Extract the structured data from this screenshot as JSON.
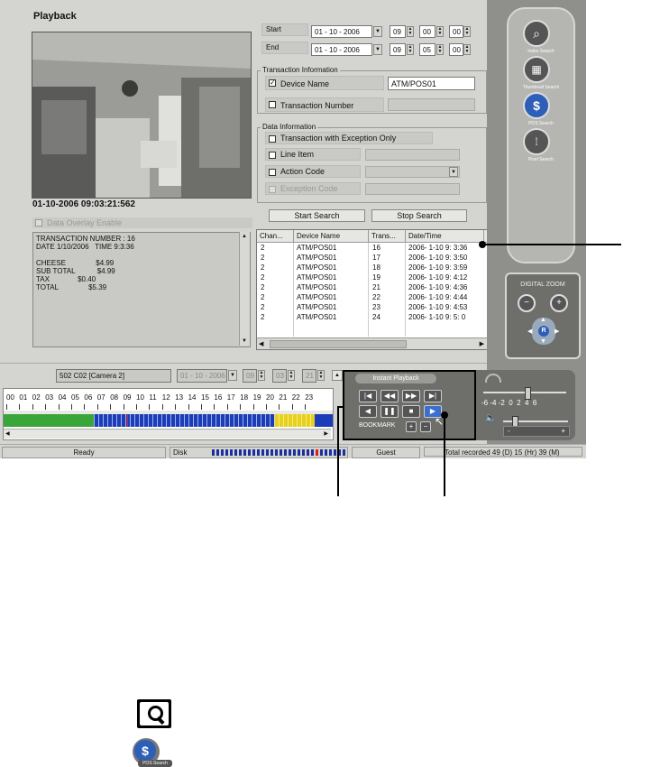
{
  "title": "Playback",
  "timestamp": "01-10-2006 09:03:21:562",
  "overlay_label": "Data Overlay Enable",
  "overlay_text": "TRANSACTION NUMBER : 16\nDATE 1/10/2006   TIME 9:3:36\n\nCHEESE               $4.99\nSUB TOTAL           $4.99\nTAX              $0.40\nTOTAL               $5.39",
  "time_range": {
    "start_label": "Start",
    "end_label": "End",
    "start_date": "01 - 10 - 2006",
    "start_h": "09",
    "start_m": "00",
    "start_s": "00",
    "end_date": "01 - 10 - 2006",
    "end_h": "09",
    "end_m": "05",
    "end_s": "00"
  },
  "transaction_info": {
    "title": "Transaction Information",
    "device_name_label": "Device Name",
    "device_name_value": "ATM/POS01",
    "transaction_number_label": "Transaction Number"
  },
  "data_info": {
    "title": "Data Information",
    "exception_only_label": "Transaction with Exception Only",
    "line_item_label": "Line Item",
    "action_code_label": "Action Code",
    "exception_code_label": "Exception Code"
  },
  "buttons": {
    "start_search": "Start Search",
    "stop_search": "Stop Search"
  },
  "results": {
    "columns": [
      "Chan...",
      "Device Name",
      "Trans...",
      "Date/Time"
    ],
    "rows": [
      [
        "2",
        "ATM/POS01",
        "16",
        "2006- 1-10  9: 3:36"
      ],
      [
        "2",
        "ATM/POS01",
        "17",
        "2006- 1-10  9: 3:50"
      ],
      [
        "2",
        "ATM/POS01",
        "18",
        "2006- 1-10  9: 3:59"
      ],
      [
        "2",
        "ATM/POS01",
        "19",
        "2006- 1-10  9: 4:12"
      ],
      [
        "2",
        "ATM/POS01",
        "21",
        "2006- 1-10  9: 4:36"
      ],
      [
        "2",
        "ATM/POS01",
        "22",
        "2006- 1-10  9: 4:44"
      ],
      [
        "2",
        "ATM/POS01",
        "23",
        "2006- 1-10  9: 4:53"
      ],
      [
        "2",
        "ATM/POS01",
        "24",
        "2006- 1-10  9: 5: 0"
      ]
    ]
  },
  "side_panel": {
    "index_search": "Index Search",
    "thumbnail_search": "Thumbnail Search",
    "pos_search": "POS Search",
    "pixel_search": "Pixel Search",
    "digital_zoom": "DIGITAL ZOOM",
    "zoom_center": "R"
  },
  "timeline": {
    "camera": "502 C02 [Camera 2]",
    "date": "01 - 10 - 2006",
    "h": "09",
    "m": "03",
    "s": "21",
    "hours": [
      "00",
      "01",
      "02",
      "03",
      "04",
      "05",
      "06",
      "07",
      "08",
      "09",
      "10",
      "11",
      "12",
      "13",
      "14",
      "15",
      "16",
      "17",
      "18",
      "19",
      "20",
      "21",
      "22",
      "23"
    ]
  },
  "instant_playback": {
    "title": "Instant Playback",
    "bookmark": "BOOKMARK",
    "speed_scale": "-6 -4 -2  0  2  4  6",
    "vol_minus": "-",
    "vol_plus": "+"
  },
  "status": {
    "ready": "Ready",
    "disk": "Disk",
    "user": "Guest",
    "total": "Total recorded 49 (D) 15 (Hr) 39 (M)"
  },
  "colors": {
    "timeline_green": "#3aa63a",
    "timeline_blue": "#1c3db8",
    "timeline_yellow": "#e8d020",
    "disk_blue": "#1c2fa0",
    "disk_red": "#e02020"
  }
}
